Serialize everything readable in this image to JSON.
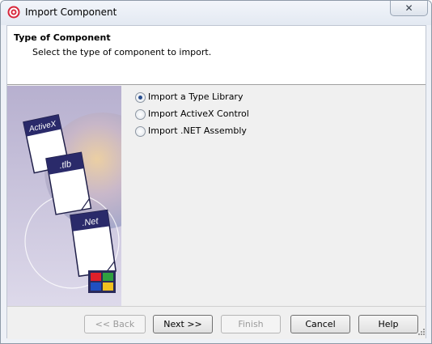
{
  "window": {
    "title": "Import Component",
    "close_label": "✕"
  },
  "header": {
    "title": "Type of Component",
    "subtitle": "Select the type of component to import."
  },
  "art": {
    "labels": [
      "ActiveX",
      ".tlb",
      ".Net"
    ]
  },
  "options": [
    {
      "label": "Import a Type Library",
      "checked": true
    },
    {
      "label": "Import ActiveX Control",
      "checked": false
    },
    {
      "label": "Import .NET Assembly",
      "checked": false
    }
  ],
  "buttons": {
    "back": "<< Back",
    "next": "Next >>",
    "finish": "Finish",
    "cancel": "Cancel",
    "help": "Help"
  },
  "colors": {
    "accent": "#2a2a6a",
    "selected_radio": "#2a4f8f"
  }
}
